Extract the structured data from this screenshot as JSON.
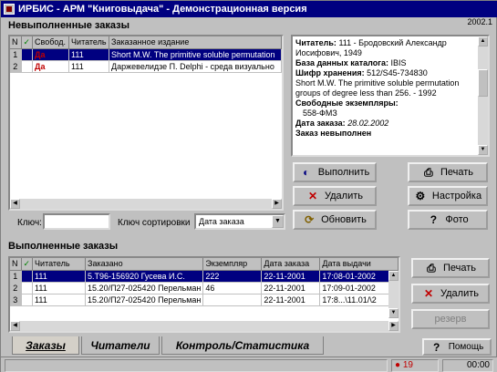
{
  "window": {
    "title": "ИРБИС - АРМ \"Книговыдача\" - Демонстрационная версия",
    "version": "2002.1"
  },
  "pending": {
    "title": "Невыполненные заказы",
    "columns": [
      "N",
      "",
      "Свобод.",
      "Читатель",
      "Заказанное издание"
    ],
    "rows": [
      {
        "n": "1",
        "flag": "Да",
        "reader": "111",
        "item": "Short M.W. The primitive soluble permutation"
      },
      {
        "n": "2",
        "flag": "Да",
        "reader": "111",
        "item": "Даржевелидзе П. Delphi - среда визуально"
      }
    ],
    "key_label": "Ключ:",
    "key_value": "",
    "sort_label": "Ключ сортировки",
    "sort_value": "Дата заказа"
  },
  "details": {
    "reader_label": "Читатель:",
    "reader_value": "111 - Бродовский Александр Иосифович, 1949",
    "db_label": "База данных каталога:",
    "db_value": "IBIS",
    "shelf_label": "Шифр хранения:",
    "shelf_value": "512/S45-734830",
    "description": "Short M.W. The primitive soluble permutation groups of degree less than 256. - 1992",
    "free_label": "Свободные экземпляры:",
    "free_value": "558-ФМЗ",
    "date_label": "Дата заказа:",
    "date_value": "28.02.2002",
    "status_text": "Заказ невыполнен"
  },
  "actions": {
    "execute": "Выполнить",
    "delete": "Удалить",
    "refresh": "Обновить",
    "print": "Печать",
    "settings": "Настройка",
    "photo": "Фото"
  },
  "done": {
    "title": "Выполненные заказы",
    "columns": [
      "N",
      "",
      "Читатель",
      "Заказано",
      "Экземпляр",
      "Дата заказа",
      "Дата выдачи"
    ],
    "rows": [
      {
        "n": "1",
        "reader": "111",
        "ordered": "5.Т96-156920 Гусева И.С.",
        "copy": "222",
        "order_date": "22-11-2001",
        "issue_date": "17:08-01-2002"
      },
      {
        "n": "2",
        "reader": "111",
        "ordered": "15.20/П27-025420 Перельман",
        "copy": "46",
        "order_date": "22-11-2001",
        "issue_date": "17:09-01-2002"
      },
      {
        "n": "3",
        "reader": "111",
        "ordered": "15.20/П27-025420 Перельман",
        "copy": "",
        "order_date": "22-11-2001",
        "issue_date": "17:8...\\11.01/\\2"
      }
    ],
    "print": "Печать",
    "delete": "Удалить",
    "reserve": "резерв"
  },
  "tabs": [
    "Заказы",
    "Читатели",
    "Контроль/Статистика"
  ],
  "help": "Помощь",
  "status": {
    "counter": "19",
    "time": "00:00"
  },
  "colors": {
    "title_bar": "#000080",
    "selection": "#000080",
    "flag_red": "#c00000",
    "window": "#c0c0c0"
  }
}
